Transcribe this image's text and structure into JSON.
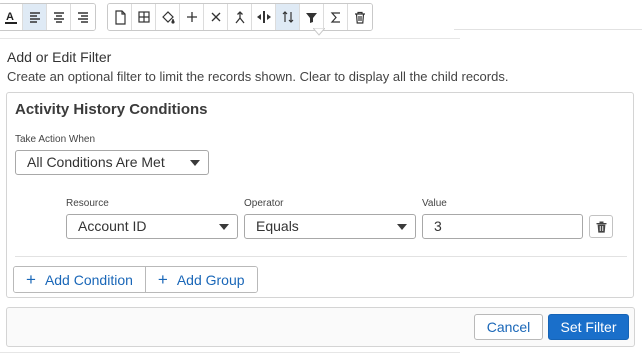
{
  "toolbar": {
    "group1": [
      "text-color-icon",
      "align-left-icon",
      "align-center-icon",
      "align-right-icon"
    ],
    "group2": [
      "page-icon",
      "table-icon",
      "fill-icon",
      "add-icon",
      "close-icon",
      "merge-icon",
      "split-icon",
      "sort-icon",
      "filter-icon",
      "sum-icon",
      "delete-icon"
    ],
    "active": [
      "align-left-icon",
      "sort-icon"
    ]
  },
  "filter": {
    "title": "Add or Edit Filter",
    "description": "Create an optional filter to limit the records shown. Clear to display all the child records."
  },
  "conditions": {
    "title": "Activity History Conditions",
    "take_action_label": "Take Action When",
    "take_action_value": "All Conditions Are Met",
    "resource_label": "Resource",
    "resource_value": "Account ID",
    "operator_label": "Operator",
    "operator_value": "Equals",
    "value_label": "Value",
    "value_value": "3",
    "add_condition_label": "Add Condition",
    "add_group_label": "Add Group",
    "plus_symbol": "+"
  },
  "footer": {
    "cancel_label": "Cancel",
    "set_filter_label": "Set Filter"
  },
  "colors": {
    "accent": "#1a6fca",
    "link": "#1a67b8",
    "active_tool_bg": "#dfeaf5"
  }
}
